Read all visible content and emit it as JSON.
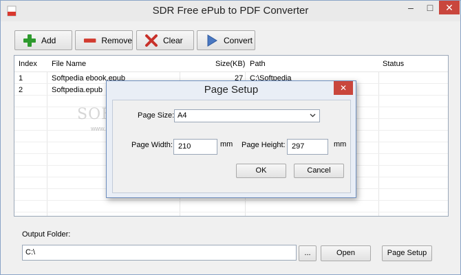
{
  "window": {
    "title": "SDR Free ePub to PDF Converter",
    "min_glyph": "–",
    "max_glyph": "□",
    "close_glyph": "✕"
  },
  "toolbar": {
    "add_label": "Add",
    "remove_label": "Remove",
    "clear_label": "Clear",
    "convert_label": "Convert"
  },
  "table": {
    "columns": [
      "Index",
      "File Name",
      "Size(KB)",
      "Path",
      "Status"
    ],
    "rows": [
      {
        "index": "1",
        "file_name": "Softpedia ebook.epub",
        "size": "27",
        "path": "C:\\Softpedia",
        "status": ""
      },
      {
        "index": "2",
        "file_name": "Softpedia.epub",
        "size": "",
        "path": "",
        "status": ""
      }
    ]
  },
  "output": {
    "label": "Output Folder:",
    "value": "C:\\",
    "browse_label": "...",
    "open_label": "Open",
    "page_setup_label": "Page Setup"
  },
  "watermark": {
    "text": "SOFTPEDIA",
    "url": "www.softpedia.com"
  },
  "dialog": {
    "title": "Page Setup",
    "close_glyph": "✕",
    "page_size_label": "Page Size:",
    "page_size_value": "A4",
    "page_width_label": "Page Width:",
    "page_width_value": "210",
    "page_width_unit": "mm",
    "page_height_label": "Page Height:",
    "page_height_value": "297",
    "page_height_unit": "mm",
    "ok_label": "OK",
    "cancel_label": "Cancel"
  },
  "colors": {
    "close_button": "#c9463d",
    "add_icon": "#2e9a2e",
    "remove_icon": "#d23b2f",
    "clear_icon": "#c8312a",
    "convert_icon": "#4a78c2"
  }
}
